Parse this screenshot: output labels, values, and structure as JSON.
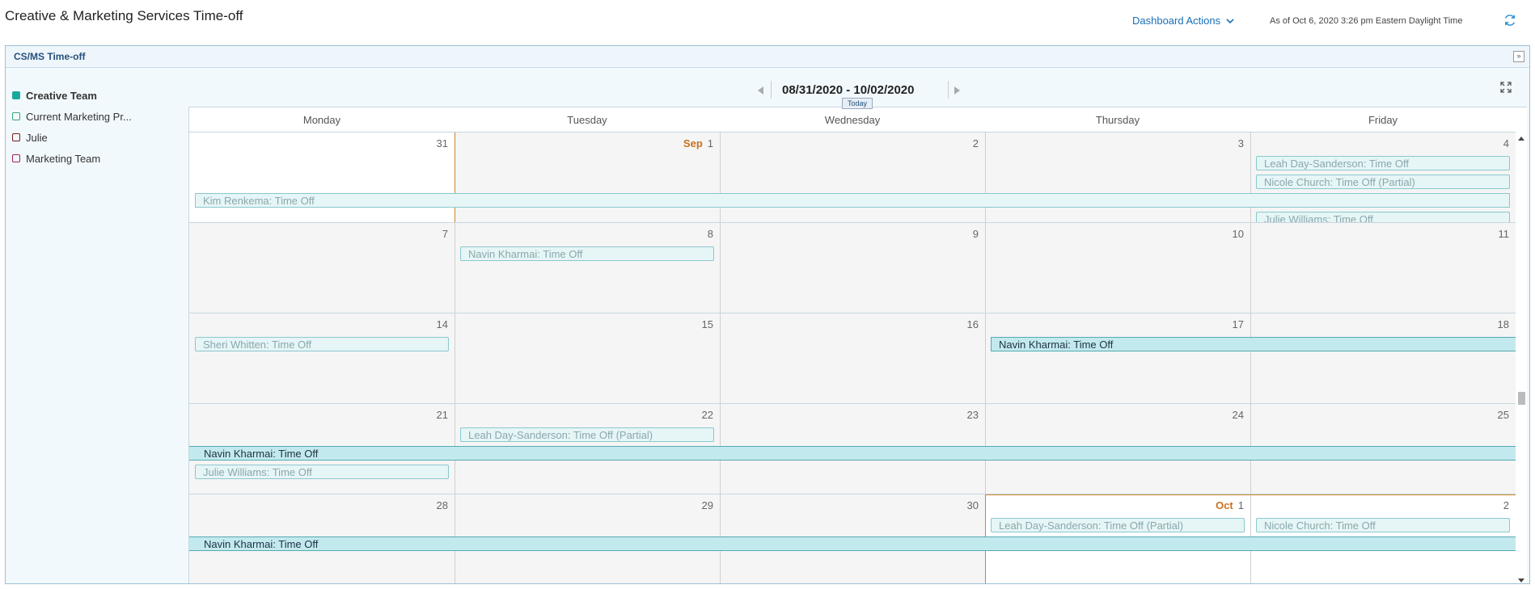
{
  "page": {
    "title": "Creative & Marketing Services Time-off",
    "dashboard_actions": "Dashboard Actions",
    "as_of": "As of  Oct 6, 2020 3:26 pm Eastern Daylight Time"
  },
  "panel": {
    "title": "CS/MS Time-off",
    "collapse_glyph": "»"
  },
  "legend": [
    {
      "label": "Creative Team",
      "color": "#1aa89c",
      "filled": true,
      "bold": true
    },
    {
      "label": "Current Marketing Pr...",
      "color": "#3aa17a",
      "filled": false,
      "bold": false
    },
    {
      "label": "Julie",
      "color": "#7a1a1a",
      "filled": false,
      "bold": false
    },
    {
      "label": "Marketing Team",
      "color": "#a0205e",
      "filled": false,
      "bold": false
    }
  ],
  "nav": {
    "range": "08/31/2020 - 10/02/2020",
    "today": "Today"
  },
  "weekdays": [
    "Monday",
    "Tuesday",
    "Wednesday",
    "Thursday",
    "Friday"
  ],
  "weeks": [
    {
      "days": [
        {
          "num": "31"
        },
        {
          "num": "1",
          "mon": "Sep"
        },
        {
          "num": "2"
        },
        {
          "num": "3"
        },
        {
          "num": "4"
        }
      ]
    },
    {
      "days": [
        {
          "num": "7"
        },
        {
          "num": "8"
        },
        {
          "num": "9"
        },
        {
          "num": "10"
        },
        {
          "num": "11"
        }
      ]
    },
    {
      "days": [
        {
          "num": "14"
        },
        {
          "num": "15"
        },
        {
          "num": "16"
        },
        {
          "num": "17"
        },
        {
          "num": "18"
        }
      ]
    },
    {
      "days": [
        {
          "num": "21"
        },
        {
          "num": "22"
        },
        {
          "num": "23"
        },
        {
          "num": "24"
        },
        {
          "num": "25"
        }
      ]
    },
    {
      "days": [
        {
          "num": "28"
        },
        {
          "num": "29"
        },
        {
          "num": "30"
        },
        {
          "num": "1",
          "mon": "Oct"
        },
        {
          "num": "2"
        }
      ]
    }
  ],
  "events": {
    "w0_leah": "Leah Day-Sanderson: Time Off",
    "w0_nicole": "Nicole Church: Time Off (Partial)",
    "w0_kim": "Kim Renkema: Time Off",
    "w0_julie": "Julie Williams: Time Off",
    "w1_navin": "Navin Kharmai: Time Off",
    "w2_sheri": "Sheri Whitten: Time Off",
    "w2_navin": "Navin Kharmai: Time Off",
    "w3_leah": "Leah Day-Sanderson: Time Off (Partial)",
    "w3_navin": "Navin Kharmai: Time Off",
    "w3_julie": "Julie Williams: Time Off",
    "w4_leah": "Leah Day-Sanderson: Time Off (Partial)",
    "w4_nicole": "Nicole Church: Time Off",
    "w4_navin": "Navin Kharmai: Time Off"
  },
  "colors": {
    "accent": "#1a6fb5",
    "today_border": "#c88a2a",
    "event_solid": "#c2eaee",
    "event_light": "#e6f5f6"
  }
}
